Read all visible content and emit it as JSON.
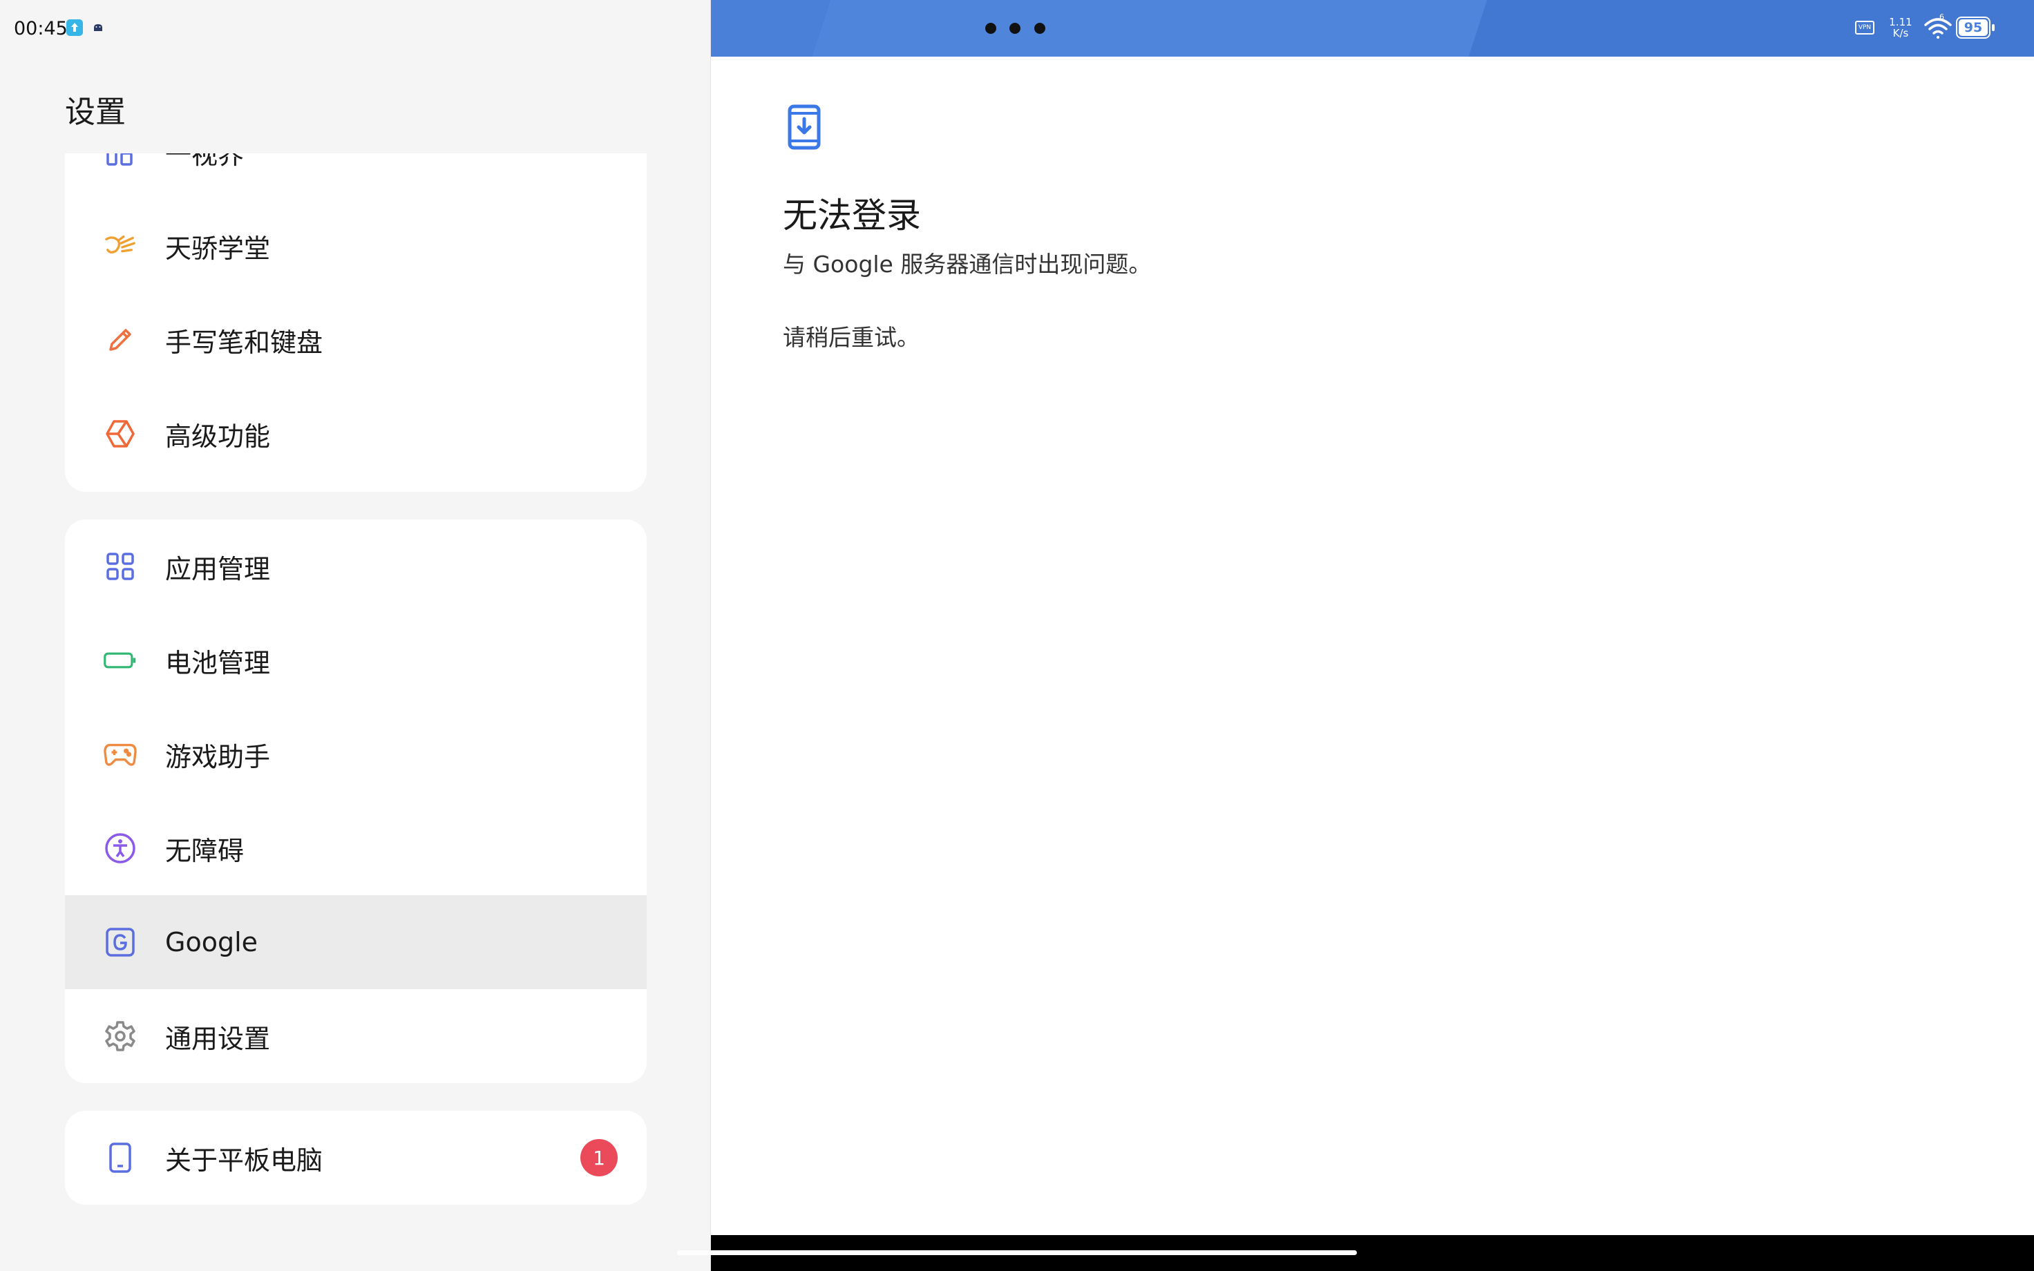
{
  "status_bar": {
    "time": "00:45",
    "speed_value": "1.11",
    "speed_unit": "K/s",
    "vpn_label": "VPN",
    "battery": "95",
    "wifi_badge": "6"
  },
  "settings": {
    "title": "设置",
    "group1": [
      {
        "label": "一视界",
        "icon": "layout-icon"
      },
      {
        "label": "天骄学堂",
        "icon": "bird-icon"
      },
      {
        "label": "手写笔和键盘",
        "icon": "pencil-icon"
      },
      {
        "label": "高级功能",
        "icon": "cube-icon"
      }
    ],
    "group2": [
      {
        "label": "应用管理",
        "icon": "apps-grid-icon"
      },
      {
        "label": "电池管理",
        "icon": "battery-icon"
      },
      {
        "label": "游戏助手",
        "icon": "gamepad-icon"
      },
      {
        "label": "无障碍",
        "icon": "accessibility-icon"
      },
      {
        "label": "Google",
        "icon": "google-icon",
        "selected": true
      },
      {
        "label": "通用设置",
        "icon": "gear-icon"
      }
    ],
    "group3": [
      {
        "label": "关于平板电脑",
        "icon": "tablet-icon",
        "badge": "1"
      }
    ]
  },
  "detail": {
    "title": "无法登录",
    "description": "与 Google 服务器通信时出现问题。",
    "retry": "请稍后重试。"
  },
  "colors": {
    "topbar": "#4a80d8",
    "selected_row": "#ebebeb",
    "badge": "#ea4a5a",
    "accent_blue": "#4a80d8"
  }
}
